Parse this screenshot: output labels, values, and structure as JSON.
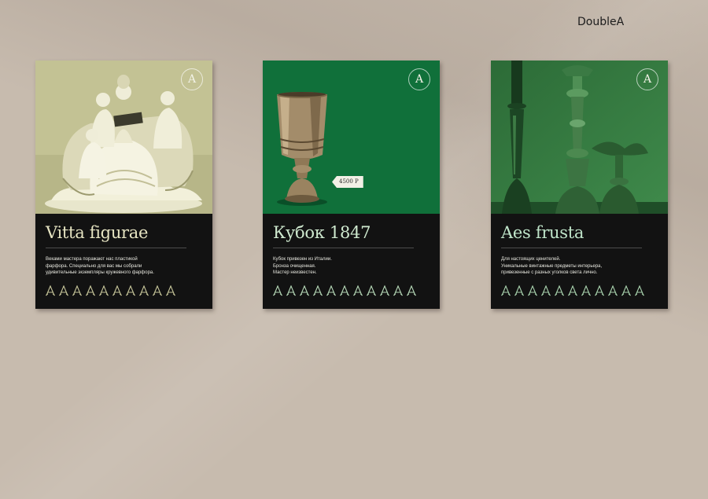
{
  "brand": {
    "name": "DoubleA"
  },
  "emblem": {
    "letter": "A"
  },
  "posters": [
    {
      "title": "Vitta figurae",
      "description_lines": [
        "Веками мастера поражают нас пластикой",
        "фарфора. Специально для вас мы собрали",
        "удивительные экземпляры кружевного фарфора."
      ],
      "photo_subject": "porcelain lace figurine",
      "photo_tint": "#c9c99a",
      "mark_count": 10
    },
    {
      "title": "Кубок 1847",
      "description_lines": [
        "Кубок привезен из Италии.",
        "Бронза очищенная.",
        "Мастер неизвестен."
      ],
      "price_tag": "4500 Р",
      "photo_subject": "bronze goblet",
      "photo_tint": "#0f6e3a",
      "mark_count": 11
    },
    {
      "title": "Aes frusta",
      "description_lines": [
        "Для настоящих ценителей.",
        "Уникальные винтажные предметы интерьера,",
        "привезенные с разных уголков света лично."
      ],
      "photo_subject": "bronze candlesticks",
      "photo_tint": "#2f7a3e",
      "mark_count": 11
    }
  ]
}
